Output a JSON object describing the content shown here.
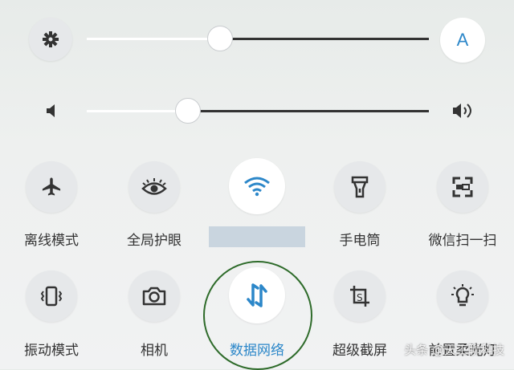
{
  "brightness": {
    "level": 0.38,
    "auto_label": "A"
  },
  "volume": {
    "level": 0.28
  },
  "tiles": [
    {
      "label": "离线模式",
      "icon": "airplane-icon"
    },
    {
      "label": "全局护眼",
      "icon": "eye-icon"
    },
    {
      "label": "",
      "icon": "wifi-icon",
      "active": true
    },
    {
      "label": "手电筒",
      "icon": "flashlight-icon"
    },
    {
      "label": "微信扫一扫",
      "icon": "scan-icon"
    },
    {
      "label": "振动模式",
      "icon": "vibrate-icon"
    },
    {
      "label": "相机",
      "icon": "camera-icon"
    },
    {
      "label": "数据网络",
      "icon": "data-network-icon",
      "active": true
    },
    {
      "label": "超级截屏",
      "icon": "screenshot-icon"
    },
    {
      "label": "前置柔光灯",
      "icon": "front-light-icon"
    }
  ],
  "watermark": "头条 @天工聊科技",
  "colors": {
    "accent": "#2c87c9",
    "ring": "#2e6b2a"
  }
}
